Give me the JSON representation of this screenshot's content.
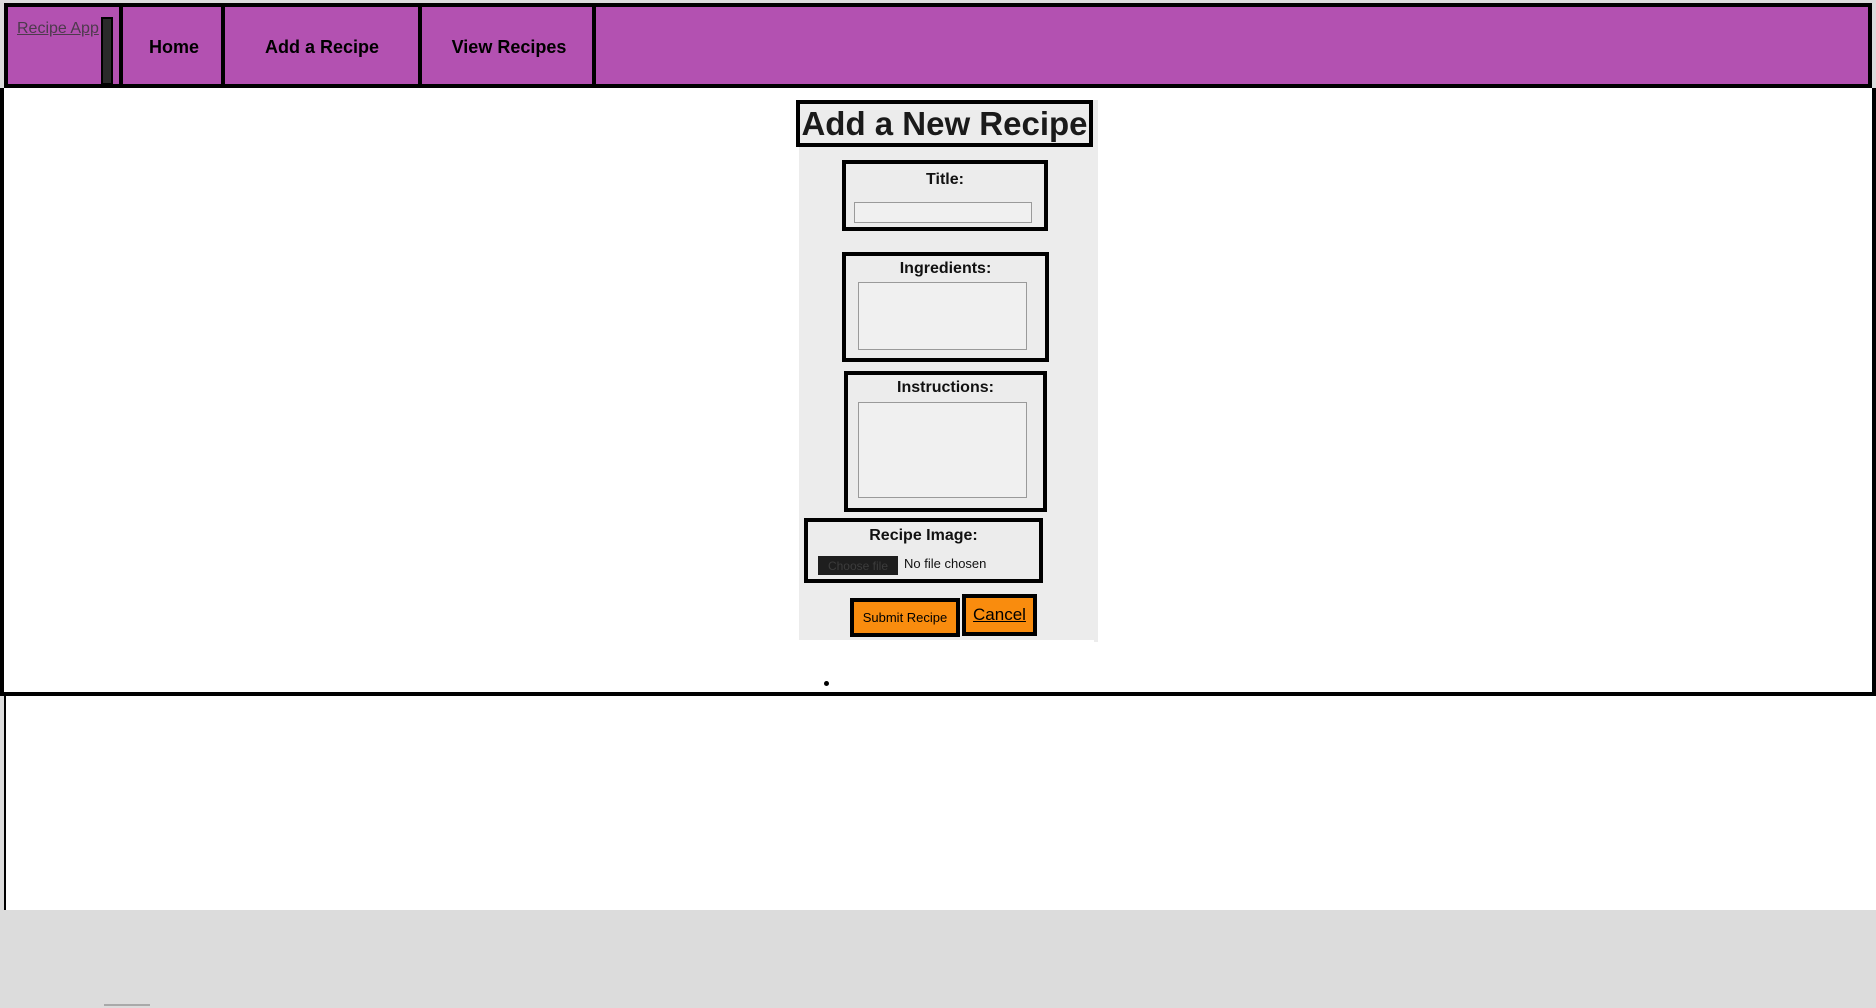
{
  "nav": {
    "brand": "Recipe App",
    "items": [
      {
        "label": "Home"
      },
      {
        "label": "Add a Recipe"
      },
      {
        "label": "View Recipes"
      }
    ]
  },
  "form": {
    "heading": "Add a New Recipe",
    "title_label": "Title:",
    "title_value": "",
    "ingredients_label": "Ingredients:",
    "ingredients_value": "",
    "instructions_label": "Instructions:",
    "instructions_value": "",
    "image_label": "Recipe Image:",
    "file_button": "Choose file",
    "file_status": "No file chosen",
    "submit_label": "Submit Recipe",
    "cancel_label": "Cancel"
  },
  "colors": {
    "nav_bg": "#b351b1",
    "button_bg": "#f98c0e",
    "form_bg": "#ececec",
    "page_bg": "#dcdcdc"
  }
}
